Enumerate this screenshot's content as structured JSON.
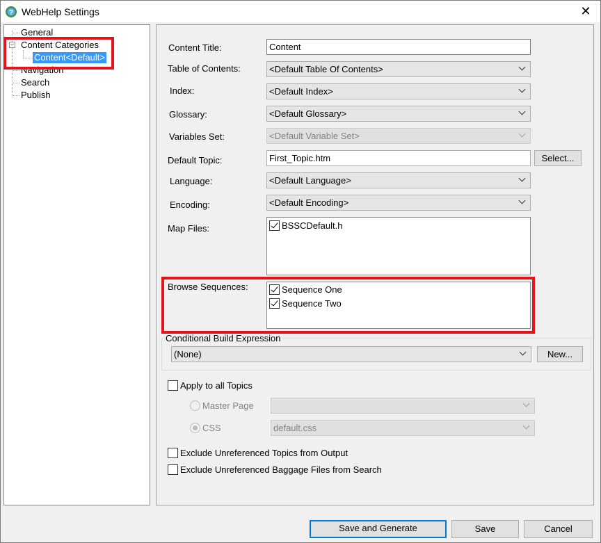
{
  "window": {
    "title": "WebHelp Settings",
    "close_glyph": "✕"
  },
  "tree": {
    "items": [
      {
        "label": "General"
      },
      {
        "label": "Content Categories"
      },
      {
        "label": "Content<Default>"
      },
      {
        "label": "Navigation"
      },
      {
        "label": "Search"
      },
      {
        "label": "Publish"
      }
    ],
    "expander_glyph": "−"
  },
  "form": {
    "content_title": {
      "label": "Content Title:",
      "value": "Content"
    },
    "toc": {
      "label": "Table of Contents:",
      "value": "<Default Table Of Contents>"
    },
    "index": {
      "label": "Index:",
      "value": "<Default Index>"
    },
    "glossary": {
      "label": "Glossary:",
      "value": "<Default Glossary>"
    },
    "variables_set": {
      "label": "Variables Set:",
      "value": "<Default Variable Set>"
    },
    "default_topic": {
      "label": "Default Topic:",
      "value": "First_Topic.htm",
      "button": "Select..."
    },
    "language": {
      "label": "Language:",
      "value": "<Default Language>"
    },
    "encoding": {
      "label": "Encoding:",
      "value": "<Default Encoding>"
    },
    "map_files": {
      "label": "Map Files:",
      "items": [
        {
          "label": "BSSCDefault.h",
          "checked": true
        }
      ]
    },
    "browse_sequences": {
      "label": "Browse Sequences:",
      "items": [
        {
          "label": "Sequence One",
          "checked": true
        },
        {
          "label": "Sequence Two",
          "checked": true
        }
      ]
    },
    "cbe": {
      "label": "Conditional Build Expression",
      "value": "(None)",
      "button": "New..."
    },
    "apply_all": {
      "label": "Apply to all Topics",
      "checked": false
    },
    "master_page": {
      "label": "Master Page",
      "value": ""
    },
    "css": {
      "label": "CSS",
      "value": "default.css"
    },
    "exclude_topics": {
      "label": "Exclude Unreferenced Topics from Output",
      "checked": false
    },
    "exclude_baggage": {
      "label": "Exclude Unreferenced Baggage Files from Search",
      "checked": false
    }
  },
  "buttons": {
    "save_generate": "Save and Generate",
    "save": "Save",
    "cancel": "Cancel"
  },
  "colors": {
    "highlight_box": "#e4141c",
    "selection": "#3399ff"
  }
}
